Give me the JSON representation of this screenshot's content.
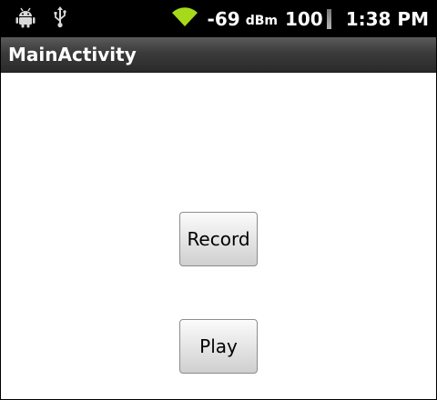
{
  "status_bar": {
    "icons": [
      "android-icon",
      "usb-icon",
      "wifi-icon"
    ],
    "signal_value": "-69",
    "signal_unit": "dBm",
    "battery_level": "100",
    "time": "1:38 PM"
  },
  "app": {
    "title": "MainActivity"
  },
  "buttons": {
    "record_label": "Record",
    "play_label": "Play"
  },
  "colors": {
    "status_bar_bg": "#000000",
    "title_bar_bg": "#3b3b3b",
    "content_bg": "#ffffff",
    "wifi_icon": "#a6d91a"
  }
}
